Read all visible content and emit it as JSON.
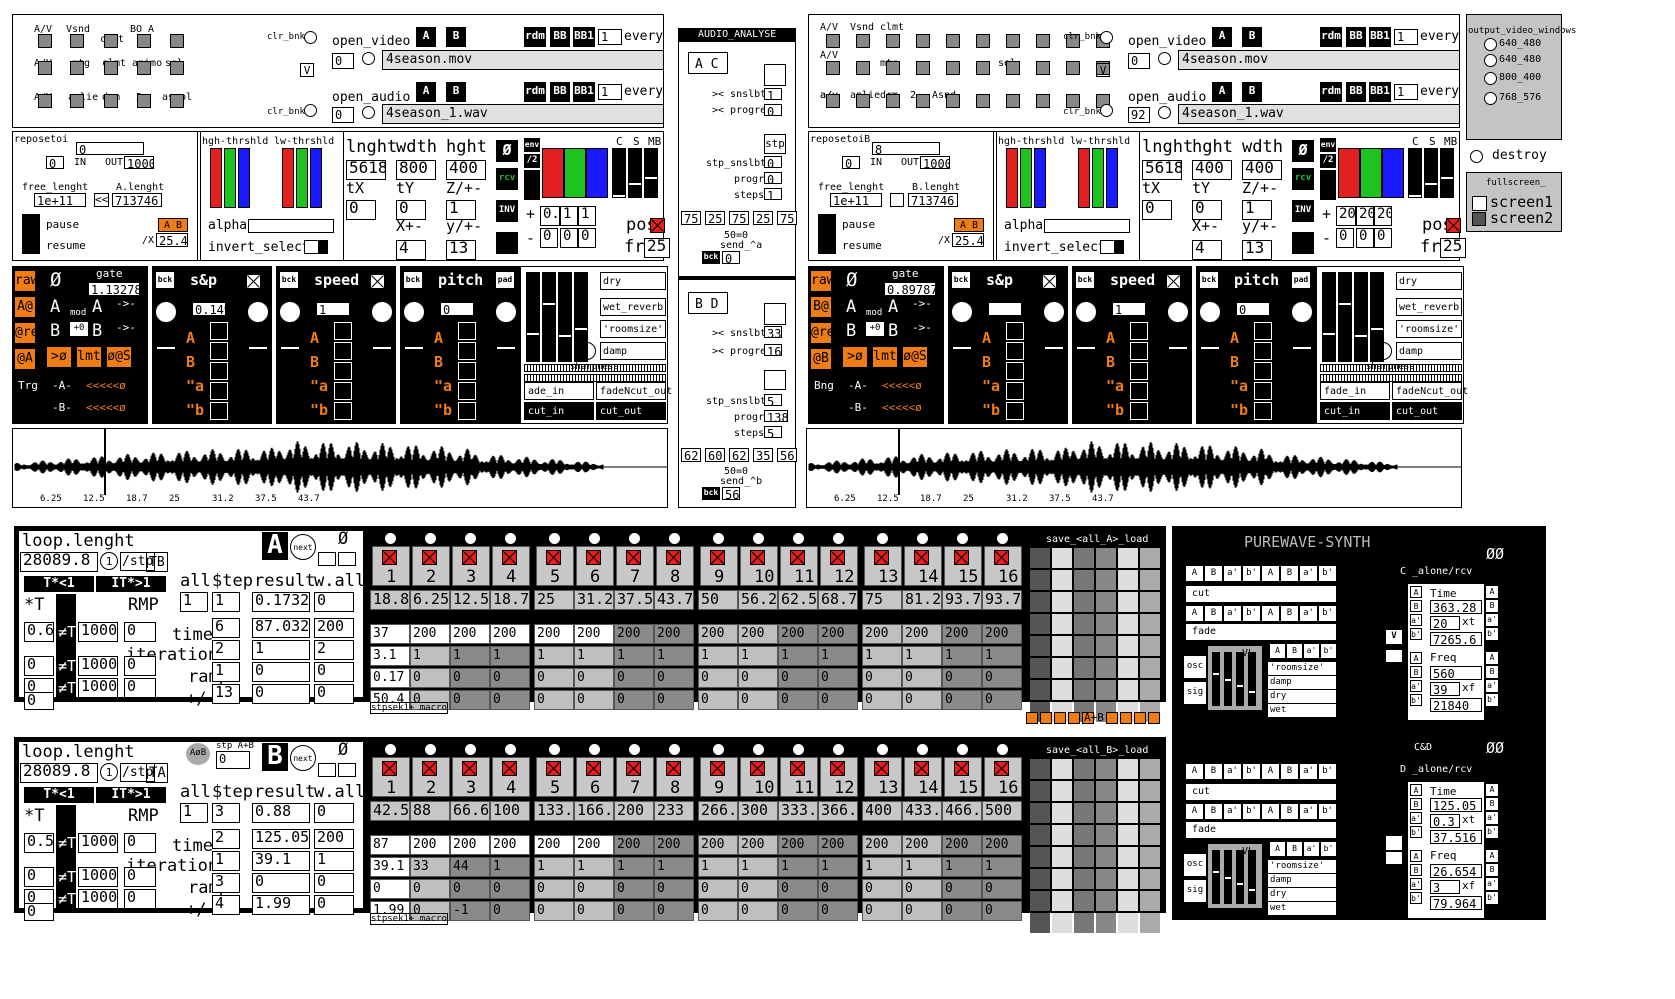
{
  "video_panel_a": {
    "labels": [
      "A/V",
      "Vsnd",
      "clmt",
      "BO_A",
      "A/V",
      "mtg",
      "clmt",
      "animo",
      "sel",
      "A/V",
      "aplie",
      "drm",
      "2",
      "asmpl"
    ],
    "clr_bnk": "clr_bnk",
    "v": "V",
    "open_video": "open_video",
    "open_audio": "open_audio",
    "a": "A",
    "b": "B",
    "rdm": "rdm",
    "bb": "BB",
    "bb1": "BB1",
    "every": "every",
    "one": "1",
    "zero": "0",
    "video_file": "4season.mov",
    "audio_file": "4season_1.wav"
  },
  "video_panel_b": {
    "labels": [
      "A/V",
      "Vsnd",
      "clmt",
      "A/V",
      "a/v",
      "mtg",
      "sel",
      "a/v",
      "aplie",
      "drm",
      "2",
      "Asnd"
    ],
    "clr_bnk": "clr_bnk",
    "v": "V",
    "open_video": "open_video",
    "open_audio": "open_audio",
    "a": "A",
    "b": "B",
    "rdm": "rdm",
    "bb": "BB",
    "bb1": "BB1",
    "every": "every",
    "one": "1",
    "zero": "0",
    "ninetytwo": "92",
    "video_file": "4season.mov",
    "audio_file": "4season_1.wav"
  },
  "output_windows": {
    "title": "output_video_windows",
    "sizes": [
      "640_480",
      "640_480",
      "800_400",
      "768_576"
    ],
    "destroy": "destroy",
    "fullscreen": "fullscreen_",
    "screen1": "screen1",
    "screen2": "screen2"
  },
  "audio_analyse": {
    "title": "AUDIO_ANALYSE",
    "ac": "A C",
    "bd": "B D",
    "snslbt": ">< snslbt",
    "progre": ">< progre",
    "stp": "stp",
    "stp_snslbt": "stp_snslbt",
    "progr": "progr",
    "steps": "steps",
    "fiftyzero": "50=0",
    "send_a": "send_^a",
    "send_b": "send_^b",
    "bck": "bck",
    "vals_a": [
      "1",
      "0",
      "0",
      "0",
      "1",
      "0",
      "5"
    ],
    "vals_b": [
      "33",
      "16",
      "5",
      "138",
      "5"
    ],
    "row_a": [
      "75",
      "25",
      "75",
      "25",
      "75"
    ],
    "row_b": [
      "62",
      "60",
      "62",
      "35",
      "56"
    ],
    "bck_a": "0",
    "bck_b": "56"
  },
  "ctrl_a": {
    "reposetoi": "reposetoi",
    "rep_val": "0",
    "in": "IN",
    "out": "OUT",
    "in_val": "0",
    "out_val": "1000",
    "free_lenght": "free_lenght",
    "a_lenght": "A.lenght",
    "free_val": "1e+11",
    "len_val": "713746",
    "arrows": "<<",
    "pause": "pause",
    "resume": "resume",
    "ab": "A B",
    "x_label": "/X",
    "x_val": "25.40",
    "hgh": "hgh-thrshld",
    "lw": "lw-thrshld",
    "alpha": "alpha",
    "invert": "invert_select",
    "lnght": "lnght",
    "wdth": "wdth",
    "hght": "hght",
    "lnght_val": "5618",
    "wdth_val": "800",
    "hght_val": "400",
    "tx": "tX",
    "ty": "tY",
    "z": "Z/+-",
    "tx_val": "0",
    "ty_val": "0",
    "z_val": "1",
    "xpm": "X+-",
    "ypm": "y/+-",
    "xpm_val": "4",
    "ypm_val": "13",
    "phi": "Ø",
    "env": "env",
    "div2": "/2",
    "rcv": "rcv",
    "inv": "INV",
    "plus": "+",
    "minus": "-",
    "p1": "0.1",
    "p2": "1",
    "m1": "0",
    "m2": "0",
    "m3": "0",
    "c": "C",
    "s": "S",
    "mb": "MB",
    "pos": "pos",
    "fr": "fr",
    "fr_val": "25"
  },
  "ctrl_b": {
    "reposetoi": "reposetoiB",
    "rep_val": "8",
    "in": "IN",
    "out": "OUT",
    "in_val": "0",
    "out_val": "1000",
    "free_lenght": "free_lenght",
    "a_lenght": "B.lenght",
    "free_val": "1e+11",
    "len_val": "713746",
    "pause": "pause",
    "resume": "resume",
    "ab": "A B",
    "x_label": "/X",
    "x_val": "25.40",
    "hgh": "hgh-thrshld",
    "lw": "lw-thrshld",
    "alpha": "alpha",
    "invert": "invert_select",
    "lnght": "lnght",
    "wdth": "hght",
    "hght": "wdth",
    "lnght_val": "5618",
    "wdth_val": "400",
    "hght_val": "400",
    "tx": "tX",
    "ty": "tY",
    "z": "Z/+-",
    "tx_val": "0",
    "ty_val": "0",
    "z_val": "1",
    "xpm": "X+-",
    "ypm": "y/+-",
    "xpm_val": "4",
    "ypm_val": "13",
    "phi": "Ø",
    "env": "env",
    "div2": "/2",
    "rcv": "rcv",
    "inv": "INV",
    "plus": "+",
    "minus": "-",
    "p1": "20",
    "p2": "20",
    "m1": "0",
    "m2": "0",
    "m3": "0",
    "c": "C",
    "s": "S",
    "mb": "MB",
    "pos": "pos",
    "fr": "fr",
    "fr_val": "25"
  },
  "fx_a": {
    "raw": "raw",
    "phi": "Ø",
    "gate": "gate",
    "gate_val": "1.13278",
    "a_at": "A@",
    "re": "@re",
    "at_a": "@A",
    "mod": "mod",
    "a": "A",
    "b": "B",
    "plus0": "+0",
    "arrow": "->-",
    "to_phi": ">ø",
    "lmt": "lmt",
    "phiphis": "ø@S",
    "trg": "Trg",
    "a_mark": "-A-",
    "b_mark": "-B-",
    "lt": "<<<<<ø",
    "bck": "bck",
    "sp": "s&p",
    "speed": "speed",
    "pitch": "pitch",
    "pad": "pad",
    "sp_val": "0.149",
    "speed_val": "1",
    "pitch_val": "0",
    "letters": [
      "A",
      "B",
      "\"a",
      "\"b"
    ],
    "dry": "dry",
    "wet_reverb": "wet_reverb",
    "roomsize": "'roomsize'",
    "damp": "damp",
    "sharpness": "sharpness",
    "fade_in": "ade_in",
    "fade_out": "fadeNcut_out",
    "cut_in": "cut_in",
    "cut_out": "cut_out",
    "ticks": [
      "6.25",
      "12.5",
      "18.7",
      "25",
      "31.2",
      "37.5",
      "43.7"
    ]
  },
  "fx_b": {
    "raw": "raw",
    "phi": "Ø",
    "gate": "gate",
    "gate_val": "0.89787",
    "a_at": "B@",
    "re": "@re",
    "at_a": "@B",
    "mod": "mod",
    "a": "A",
    "b": "B",
    "plus0": "+0",
    "arrow": "->-",
    "to_phi": ">ø",
    "lmt": "lmt",
    "phiphis": "ø@S",
    "trg": "Trg",
    "bng": "Bng",
    "a_mark": "-A-",
    "b_mark": "-B-",
    "lt": "<<<<<ø",
    "bck": "bck",
    "sp": "s&p",
    "speed": "speed",
    "pitch": "pitch",
    "pad": "pad",
    "sp_val": "",
    "speed_val": "1",
    "pitch_val": "0",
    "letters": [
      "A",
      "B",
      "\"a",
      "\"b"
    ],
    "dry": "dry",
    "wet_reverb": "wet_reverb",
    "roomsize": "'roomsize'",
    "damp": "damp",
    "sharpness": "sharpness",
    "fade_in": "fade_in",
    "fade_out": "fadeNcut_out",
    "cut_in": "cut_in",
    "cut_out": "cut_out",
    "ticks": [
      "6.25",
      "12.5",
      "18.7",
      "25",
      "31.2",
      "37.5",
      "43.7"
    ]
  },
  "seq_a": {
    "loop": "loop.lenght",
    "loop_val": "28089.8",
    "one": "1",
    "stp": "/stp",
    "tb": "TB",
    "letter": "A",
    "next": "next",
    "phi": "Ø",
    "t_lt": "T*<1",
    "t_gt": "IT*>1",
    "star_t": "*T",
    "rmp": "RMP",
    "all": "all",
    "step": "$tep",
    "result": "result",
    "wall": "w.all",
    "time": "time",
    "iteration": "iteration",
    "rampe": "rampe",
    "plusminus": "+/-",
    "neq": "≠T",
    "left": [
      {
        "a": "0.6",
        "b": "1000",
        "c": "0"
      },
      {
        "a": "0",
        "b": "1000",
        "c": "0"
      },
      {
        "a": "0",
        "b": "1000",
        "c": "0"
      }
    ],
    "grid": [
      [
        "1",
        "1",
        "0.1732",
        "0"
      ],
      [
        "6",
        "87.032",
        "200"
      ],
      [
        "2",
        "1",
        "2"
      ],
      [
        "1",
        "0",
        "0"
      ],
      [
        "13",
        "0",
        "0"
      ]
    ],
    "steps": [
      "1",
      "2",
      "3",
      "4",
      "5",
      "6",
      "7",
      "8",
      "9",
      "10",
      "11",
      "12",
      "13",
      "14",
      "15",
      "16"
    ],
    "r1": [
      "18.8",
      "6.25",
      "12.5",
      "18.7",
      "25",
      "31.2",
      "37.5",
      "43.7",
      "50",
      "56.2",
      "62.5",
      "68.7",
      "75",
      "81.2",
      "93.7",
      "93.7"
    ],
    "r2": [
      "37",
      "200",
      "200",
      "200",
      "200",
      "200",
      "200",
      "200",
      "200",
      "200",
      "200",
      "200",
      "200",
      "200",
      "200",
      "200"
    ],
    "r3": [
      "3.1",
      "1",
      "1",
      "1",
      "1",
      "1",
      "1",
      "1",
      "1",
      "1",
      "1",
      "1",
      "1",
      "1",
      "1",
      "1"
    ],
    "r4": [
      "0.17",
      "0",
      "0",
      "0",
      "0",
      "0",
      "0",
      "0",
      "0",
      "0",
      "0",
      "0",
      "0",
      "0",
      "0",
      "0"
    ],
    "r5": [
      "50.4",
      "0",
      "0",
      "0",
      "0",
      "0",
      "0",
      "0",
      "0",
      "0",
      "0",
      "0",
      "0",
      "0",
      "0",
      "0"
    ],
    "macro": "stpsek1+ macro",
    "save": "save_<all_A>_load",
    "ab": "A+B"
  },
  "seq_b": {
    "loop": "loop.lenght",
    "loop_val": "28089.8",
    "one": "1",
    "stp": "/stp",
    "tb": "TA",
    "letter": "B",
    "next": "next",
    "phi": "Ø",
    "stp_ab": "stp A+B",
    "stp_ab_val": "0",
    "aob": "AøB",
    "t_lt": "T*<1",
    "t_gt": "IT*>1",
    "star_t": "*T",
    "rmp": "RMP",
    "all": "all",
    "step": "$tep",
    "result": "result",
    "wall": "w.all",
    "time": "time",
    "iteration": "iteration",
    "rampe": "rampe",
    "plusminus": "+/-",
    "neq": "≠T",
    "left": [
      {
        "a": "0.5",
        "b": "1000",
        "c": "0"
      },
      {
        "a": "0",
        "b": "1000",
        "c": "0"
      },
      {
        "a": "0",
        "b": "1000",
        "c": "0"
      }
    ],
    "grid": [
      [
        "1",
        "3",
        "0.88",
        "0"
      ],
      [
        "2",
        "125.05",
        "200"
      ],
      [
        "1",
        "39.1",
        "1"
      ],
      [
        "3",
        "0",
        "0"
      ],
      [
        "4",
        "1.99",
        "0"
      ]
    ],
    "steps": [
      "1",
      "2",
      "3",
      "4",
      "5",
      "6",
      "7",
      "8",
      "9",
      "10",
      "11",
      "12",
      "13",
      "14",
      "15",
      "16"
    ],
    "r1": [
      "42.5",
      "88",
      "66.6",
      "100",
      "133.",
      "166.",
      "200",
      "233",
      "266.",
      "300",
      "333.",
      "366.",
      "400",
      "433.",
      "466.",
      "500"
    ],
    "r2": [
      "87",
      "200",
      "200",
      "200",
      "200",
      "200",
      "200",
      "200",
      "200",
      "200",
      "200",
      "200",
      "200",
      "200",
      "200",
      "200"
    ],
    "r3": [
      "39.1",
      "33",
      "44",
      "1",
      "1",
      "1",
      "1",
      "1",
      "1",
      "1",
      "1",
      "1",
      "1",
      "1",
      "1",
      "1"
    ],
    "r4": [
      "0",
      "0",
      "0",
      "0",
      "0",
      "0",
      "0",
      "0",
      "0",
      "0",
      "0",
      "0",
      "0",
      "0",
      "0",
      "0"
    ],
    "r5": [
      "1.99",
      "0",
      "-1",
      "0",
      "0",
      "0",
      "0",
      "0",
      "0",
      "0",
      "0",
      "0",
      "0",
      "0",
      "0",
      "0"
    ],
    "macro": "stpsek1+ macro",
    "save": "save_<all_B>_load"
  },
  "synth": {
    "title": "PUREWAVE-SYNTH",
    "cut": "cut",
    "fade": "fade",
    "osc": "osc",
    "sig": "sig",
    "vl": "VL",
    "roomsize": "'roomsize'",
    "damp": "damp",
    "dry": "dry",
    "wet": "wet",
    "tabs": [
      "A",
      "B",
      "a'",
      "b'",
      "A",
      "B",
      "a'",
      "b'"
    ],
    "c_alone": "C  _alone/rcv",
    "d_alone": "D  _alone/rcv",
    "cd": "C&D",
    "ab": "A B",
    "time": "Time",
    "freq": "Freq",
    "c_vals": {
      "t1": "363.28",
      "t2": "20",
      "t3": "7265.6",
      "f1": "560",
      "f2": "39",
      "f3": "21840"
    },
    "d_vals": {
      "t1": "125.05",
      "t2": "0.3",
      "t3": "37.516",
      "f1": "26.654",
      "f2": "3",
      "f3": "79.964"
    },
    "xt": "xt",
    "xf": "xf",
    "phiphi": "ØØ",
    "v": "V"
  }
}
